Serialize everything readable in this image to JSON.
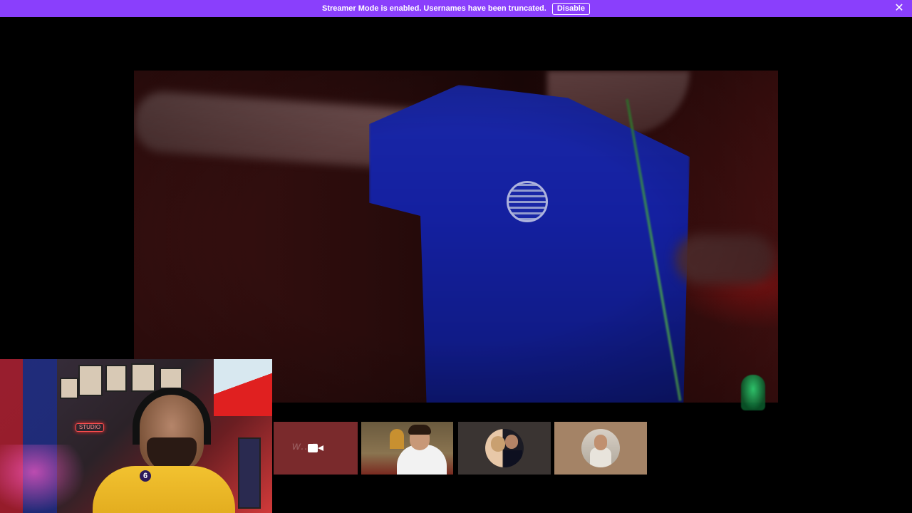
{
  "banner": {
    "message": "Streamer Mode is enabled. Usernames have been truncated.",
    "disable_label": "Disable",
    "close_glyph": "✕",
    "color": "#8a3ffc"
  },
  "main_stream": {
    "description": "participant video"
  },
  "webcam": {
    "studio_sign": "STUDIO",
    "jersey_number": "6"
  },
  "participants": [
    {
      "state": "camera-off",
      "icon": "video-camera-icon",
      "faint_name": "w…z"
    },
    {
      "state": "video"
    },
    {
      "state": "avatar"
    },
    {
      "state": "avatar"
    }
  ]
}
